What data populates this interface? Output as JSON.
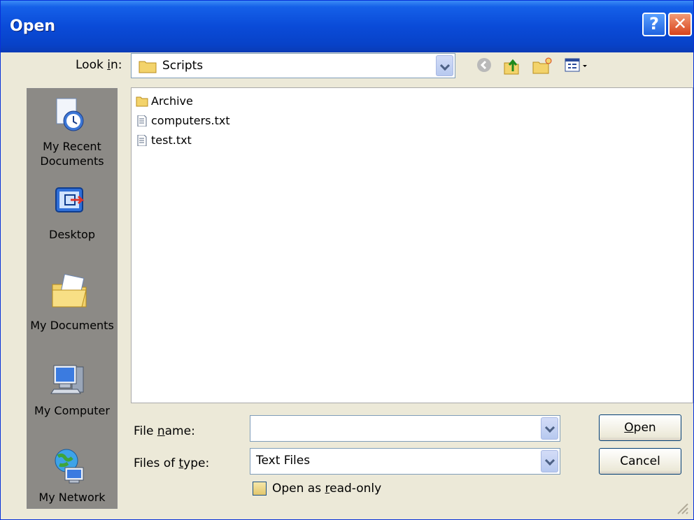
{
  "window": {
    "title": "Open",
    "help_glyph": "?",
    "close_glyph": "✕"
  },
  "lookin": {
    "label_prefix": "Look ",
    "label_accel": "i",
    "label_suffix": "n:",
    "value": "Scripts",
    "icon": "folder-icon"
  },
  "toolbar": {
    "icons": [
      "back-icon",
      "up-folder-icon",
      "new-folder-icon",
      "views-menu-icon"
    ]
  },
  "places": [
    {
      "label": "My Recent Documents",
      "icon": "recent-documents-icon"
    },
    {
      "label": "Desktop",
      "icon": "desktop-icon"
    },
    {
      "label": "My Documents",
      "icon": "my-documents-icon"
    },
    {
      "label": "My Computer",
      "icon": "my-computer-icon"
    },
    {
      "label": "My Network",
      "icon": "my-network-icon"
    }
  ],
  "files": [
    {
      "name": "Archive",
      "icon": "folder-icon"
    },
    {
      "name": "computers.txt",
      "icon": "text-file-icon"
    },
    {
      "name": "test.txt",
      "icon": "text-file-icon"
    }
  ],
  "filename": {
    "label_prefix": "File ",
    "label_accel": "n",
    "label_suffix": "ame:",
    "value": ""
  },
  "filetype": {
    "label_prefix": "Files of ",
    "label_accel": "t",
    "label_suffix": "ype:",
    "value": "Text Files"
  },
  "readonly": {
    "label_prefix": "Open as ",
    "label_accel": "r",
    "label_suffix": "ead-only",
    "checked": false
  },
  "buttons": {
    "open_accel": "O",
    "open_rest": "pen",
    "cancel": "Cancel"
  },
  "colors": {
    "title_bar": "#0a4bd8",
    "dialog_bg": "#ece9d8",
    "places_bar": "#8c8a86",
    "folder": "#f3d36b"
  }
}
